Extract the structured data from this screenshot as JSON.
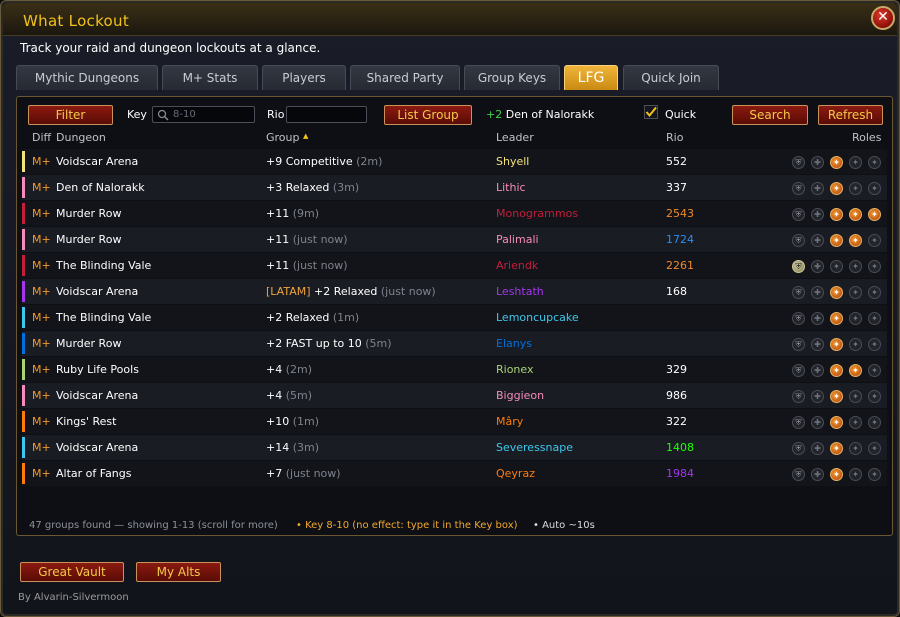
{
  "window": {
    "title": "What Lockout",
    "subtitle": "Track your raid and dungeon lockouts at a glance.",
    "close_label": "✕"
  },
  "tabs": [
    {
      "label": "Mythic Dungeons"
    },
    {
      "label": "M+ Stats"
    },
    {
      "label": "Players"
    },
    {
      "label": "Shared Party"
    },
    {
      "label": "Group Keys"
    },
    {
      "label": "LFG",
      "active": true
    },
    {
      "label": "Quick Join"
    }
  ],
  "toolbar": {
    "filter_label": "Filter",
    "key_label": "Key",
    "key_placeholder": "8-10",
    "rio_label": "Rio",
    "rio_value": "",
    "list_group_label": "List Group",
    "listed_text": "+2 Den of Nalorakk",
    "listed_key": "+2",
    "listed_name": "Den of Nalorakk",
    "quick_label": "Quick",
    "quick_checked": true,
    "search_label": "Search",
    "refresh_label": "Refresh"
  },
  "columns": {
    "diff": "Diff",
    "dungeon": "Dungeon",
    "group": "Group",
    "sort_arrow": "▲",
    "leader": "Leader",
    "rio": "Rio",
    "roles": "Roles"
  },
  "rows": [
    {
      "diff": "M+",
      "dungeon": "Voidscar Arena",
      "tag": "",
      "group": "+9 Competitive",
      "time": "(2m)",
      "leader": "Shyell",
      "leader_color": "#f4e27a",
      "rio": "552",
      "rio_color": "#ffffff",
      "bar_color": "#f4e27a",
      "roles": [
        0,
        0,
        1,
        0,
        0
      ]
    },
    {
      "diff": "M+",
      "dungeon": "Den of Nalorakk",
      "tag": "",
      "group": "+3 Relaxed",
      "time": "(3m)",
      "leader": "Lithic",
      "leader_color": "#f58cba",
      "rio": "337",
      "rio_color": "#ffffff",
      "bar_color": "#f58cba",
      "roles": [
        0,
        0,
        1,
        0,
        0
      ]
    },
    {
      "diff": "M+",
      "dungeon": "Murder Row",
      "tag": "",
      "group": "+11",
      "time": "(9m)",
      "leader": "Monogrammos",
      "leader_color": "#c41e3a",
      "rio": "2543",
      "rio_color": "#f08a2a",
      "bar_color": "#c41e3a",
      "roles": [
        0,
        0,
        1,
        1,
        1
      ]
    },
    {
      "diff": "M+",
      "dungeon": "Murder Row",
      "tag": "",
      "group": "+11",
      "time": "(just now)",
      "leader": "Palimali",
      "leader_color": "#f58cba",
      "rio": "1724",
      "rio_color": "#2a8cf0",
      "bar_color": "#f58cba",
      "roles": [
        0,
        0,
        1,
        1,
        0
      ]
    },
    {
      "diff": "M+",
      "dungeon": "The Blinding Vale",
      "tag": "",
      "group": "+11",
      "time": "(just now)",
      "leader": "Ariendk",
      "leader_color": "#c41e3a",
      "rio": "2261",
      "rio_color": "#f08a2a",
      "bar_color": "#c41e3a",
      "roles": [
        1,
        0,
        0,
        0,
        0
      ]
    },
    {
      "diff": "M+",
      "dungeon": "Voidscar Arena",
      "tag": "[LATAM]",
      "group": "+2 Relaxed",
      "time": "(just now)",
      "leader": "Leshtath",
      "leader_color": "#a335ee",
      "rio": "168",
      "rio_color": "#ffffff",
      "bar_color": "#a335ee",
      "roles": [
        0,
        0,
        1,
        0,
        0
      ]
    },
    {
      "diff": "M+",
      "dungeon": "The Blinding Vale",
      "tag": "",
      "group": "+2 Relaxed",
      "time": "(1m)",
      "leader": "Lemoncupcake",
      "leader_color": "#3fc7eb",
      "rio": "",
      "rio_color": "#ffffff",
      "bar_color": "#3fc7eb",
      "roles": [
        0,
        0,
        1,
        0,
        0
      ]
    },
    {
      "diff": "M+",
      "dungeon": "Murder Row",
      "tag": "",
      "group": "+2 FAST up to 10",
      "time": "(5m)",
      "leader": "Elanys",
      "leader_color": "#0070dd",
      "rio": "",
      "rio_color": "#ffffff",
      "bar_color": "#0070dd",
      "roles": [
        0,
        0,
        1,
        0,
        0
      ]
    },
    {
      "diff": "M+",
      "dungeon": "Ruby Life Pools",
      "tag": "",
      "group": "+4",
      "time": "(2m)",
      "leader": "Rionex",
      "leader_color": "#aad372",
      "rio": "329",
      "rio_color": "#ffffff",
      "bar_color": "#aad372",
      "roles": [
        0,
        0,
        1,
        1,
        0
      ]
    },
    {
      "diff": "M+",
      "dungeon": "Voidscar Arena",
      "tag": "",
      "group": "+4",
      "time": "(5m)",
      "leader": "Biggieon",
      "leader_color": "#f58cba",
      "rio": "986",
      "rio_color": "#ffffff",
      "bar_color": "#f58cba",
      "roles": [
        0,
        0,
        1,
        0,
        0
      ]
    },
    {
      "diff": "M+",
      "dungeon": "Kings' Rest",
      "tag": "",
      "group": "+10",
      "time": "(1m)",
      "leader": "Mâry",
      "leader_color": "#ff7c0a",
      "rio": "322",
      "rio_color": "#ffffff",
      "bar_color": "#ff7c0a",
      "roles": [
        0,
        0,
        1,
        0,
        0
      ]
    },
    {
      "diff": "M+",
      "dungeon": "Voidscar Arena",
      "tag": "",
      "group": "+14",
      "time": "(3m)",
      "leader": "Severessnape",
      "leader_color": "#3fc7eb",
      "rio": "1408",
      "rio_color": "#1eff00",
      "bar_color": "#3fc7eb",
      "roles": [
        0,
        0,
        1,
        0,
        0
      ]
    },
    {
      "diff": "M+",
      "dungeon": "Altar of Fangs",
      "tag": "",
      "group": "+7",
      "time": "(just now)",
      "leader": "Qeyraz",
      "leader_color": "#ff7c0a",
      "rio": "1984",
      "rio_color": "#a335ee",
      "bar_color": "#ff7c0a",
      "roles": [
        0,
        0,
        1,
        0,
        0
      ]
    }
  ],
  "footer": {
    "count_text": "47 groups found — showing 1-13 (scroll for more)",
    "key_note": "• Key 8-10 (no effect: type it in the Key box)",
    "auto_note": "• Auto ~10s"
  },
  "bottom": {
    "great_vault_label": "Great Vault",
    "my_alts_label": "My Alts",
    "by_text": "By Alvarin-Silvermoon"
  },
  "colors": {
    "accent_gold": "#f2c21a",
    "button_red": "#8a1a10",
    "tab_active": "#e8a82a"
  }
}
